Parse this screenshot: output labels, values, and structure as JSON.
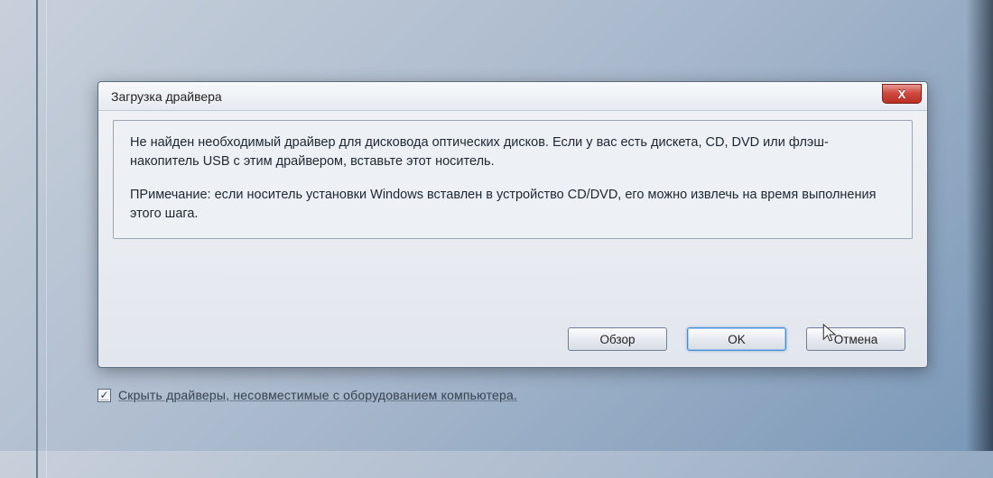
{
  "dialog": {
    "title": "Загрузка драйвера",
    "message1": "Не найден необходимый драйвер для дисковода оптических дисков. Если у вас есть дискета, CD, DVD или флэш-накопитель USB с этим драйвером, вставьте этот носитель.",
    "message2": "ПРимечание: если носитель установки Windows вставлен в устройство CD/DVD, его можно извлечь на время выполнения этого шага.",
    "buttons": {
      "browse": "Обзор",
      "ok": "OK",
      "cancel": "Отмена"
    },
    "close_glyph": "X"
  },
  "parent": {
    "hide_incompatible_label": "Скрыть драйверы, несовместимые с оборудованием компьютера.",
    "hide_incompatible_checked": true
  }
}
